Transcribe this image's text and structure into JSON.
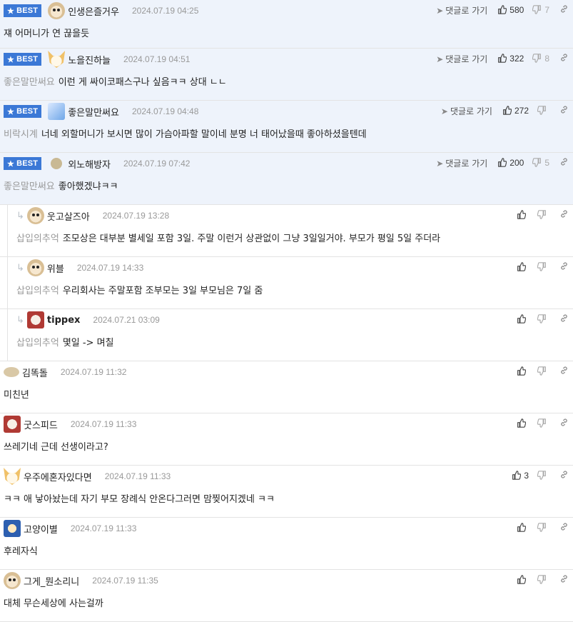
{
  "ui": {
    "best_label": "BEST",
    "goto_label": "댓글로 가기",
    "reply_arrow": "↳",
    "star_glyph": "★"
  },
  "comments": [
    {
      "type": "best",
      "avatar": "dog",
      "nick": "인생은즐거우",
      "time": "2024.07.19 04:25",
      "tag": "",
      "text": "쟤 어머니가 연 끊을듯",
      "up": "580",
      "down": "7",
      "goto": true
    },
    {
      "type": "best",
      "avatar": "fox",
      "nick": "노을진하늘",
      "time": "2024.07.19 04:51",
      "tag": "좋은말만써요",
      "text": "이런 게 싸이코패스구나 싶음ㅋㅋ 상대 ㄴㄴ",
      "up": "322",
      "down": "8",
      "goto": true
    },
    {
      "type": "best",
      "avatar": "blue",
      "nick": "좋은말만써요",
      "time": "2024.07.19 04:48",
      "tag": "비락시계",
      "text": "너네 외할머니가 보시면 많이 가슴아파할 말이네 분명 너 태어났을때 좋아하셨을텐데",
      "up": "272",
      "down": "",
      "goto": true
    },
    {
      "type": "best",
      "avatar": "dot",
      "nick": "외노해방자",
      "time": "2024.07.19 07:42",
      "tag": "좋은말만써요",
      "text": "좋아했겠냐ㅋㅋ",
      "up": "200",
      "down": "5",
      "goto": true
    },
    {
      "type": "reply",
      "avatar": "dog",
      "nick": "웃고살즈아",
      "time": "2024.07.19 13:28",
      "tag": "삽입의추억",
      "text": "조모상은 대부분 별세일 포함 3일. 주말 이런거 상관없이 그냥 3일일거야. 부모가 평일 5일 주더라",
      "up": "",
      "down": "",
      "goto": false
    },
    {
      "type": "reply",
      "avatar": "dog",
      "nick": "위블",
      "time": "2024.07.19 14:33",
      "tag": "삽입의추억",
      "text": "우리회사는 주말포함 조부모는 3일 부모님은 7일 줌",
      "up": "",
      "down": "",
      "goto": false
    },
    {
      "type": "reply",
      "avatar": "red",
      "nick": "tippex",
      "time": "2024.07.21 03:09",
      "tag": "삽입의추억",
      "text": "몇일 -> 며칠",
      "up": "",
      "down": "",
      "goto": false
    },
    {
      "type": "plain",
      "avatar": "flat",
      "nick": "김똑돌",
      "time": "2024.07.19 11:32",
      "tag": "",
      "text": "미친년",
      "up": "",
      "down": "",
      "goto": false
    },
    {
      "type": "plain",
      "avatar": "red",
      "nick": "굿스피드",
      "time": "2024.07.19 11:33",
      "tag": "",
      "text": "쓰레기네 근데 선생이라고?",
      "up": "",
      "down": "",
      "goto": false
    },
    {
      "type": "plain",
      "avatar": "fox",
      "nick": "우주에혼자있다면",
      "time": "2024.07.19 11:33",
      "tag": "",
      "text": "ㅋㅋ 애 낳아놨는데 자기 부모 장례식 안온다그러면 맘찢어지겠네 ㅋㅋ",
      "up": "3",
      "down": "",
      "goto": false
    },
    {
      "type": "plain",
      "avatar": "tiger",
      "nick": "고양이별",
      "time": "2024.07.19 11:33",
      "tag": "",
      "text": "후레자식",
      "up": "",
      "down": "",
      "goto": false
    },
    {
      "type": "plain",
      "avatar": "dog",
      "nick": "그게_뭔소리니",
      "time": "2024.07.19 11:35",
      "tag": "",
      "text": "대체 무슨세상에 사는걸까",
      "up": "",
      "down": "",
      "goto": false
    }
  ]
}
